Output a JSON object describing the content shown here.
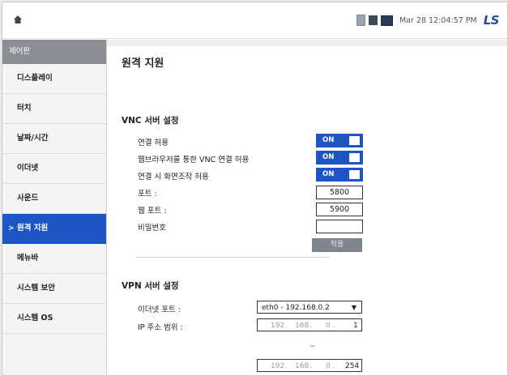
{
  "topbar": {
    "home_icon": "home-icon",
    "status_icons": [
      "document-icon",
      "storage-icon",
      "monitor-icon"
    ],
    "datetime": "Mar 28 12:04:57 PM",
    "logo": "LS"
  },
  "sidebar": {
    "header": "제어판",
    "items": [
      {
        "label": "디스플레이",
        "active": false
      },
      {
        "label": "터치",
        "active": false
      },
      {
        "label": "날짜/시간",
        "active": false
      },
      {
        "label": "이더넷",
        "active": false
      },
      {
        "label": "사운드",
        "active": false
      },
      {
        "label": "원격 지원",
        "active": true
      },
      {
        "label": "메뉴바",
        "active": false
      },
      {
        "label": "시스템 보안",
        "active": false
      },
      {
        "label": "시스템 OS",
        "active": false
      }
    ],
    "active_indicator": ">"
  },
  "main": {
    "title": "원격 지원",
    "vnc": {
      "section_title": "VNC 서버 설정",
      "allow_connection": {
        "label": "연결 허용",
        "state": "ON"
      },
      "allow_browser": {
        "label": "웹브라우저를 통한 VNC 연결 허용",
        "state": "ON"
      },
      "allow_control": {
        "label": "연결 시 화면조작 허용",
        "state": "ON"
      },
      "port": {
        "label": "포트 :",
        "value": "5800"
      },
      "web_port": {
        "label": "웹 포트 :",
        "value": "5900"
      },
      "password": {
        "label": "비밀번호",
        "value": ""
      },
      "apply_label": "적용"
    },
    "vpn": {
      "section_title": "VPN 서버 설정",
      "ethernet_port": {
        "label": "이더넷 포트 :",
        "value": "eth0 - 192.168.0.2"
      },
      "ip_range": {
        "label": "IP 주소 범위 :",
        "start": [
          "192",
          "168",
          "0",
          "1"
        ],
        "separator": "~",
        "end": [
          "192",
          "168",
          "0",
          "254"
        ]
      }
    }
  },
  "colors": {
    "accent": "#1d56c4",
    "sidebar_header": "#8a8f96",
    "apply_button": "#7f858d",
    "logo": "#2c4f91"
  }
}
